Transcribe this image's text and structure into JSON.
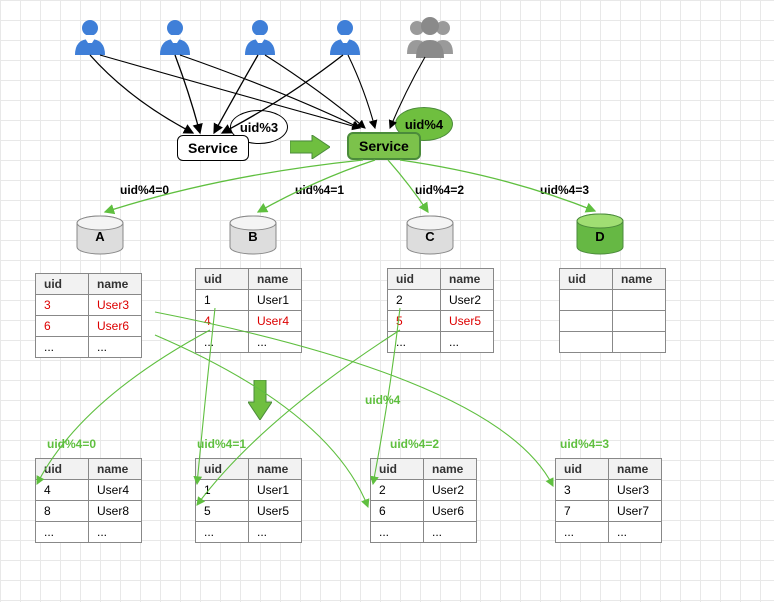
{
  "icons": {
    "user_blue": "#3f7fd8",
    "user_gray": "#9a9a9a"
  },
  "bubbles": {
    "old_rule": "uid%3",
    "new_rule": "uid%4"
  },
  "services": {
    "old": "Service",
    "new": "Service"
  },
  "routes_top": {
    "r0": "uid%4=0",
    "r1": "uid%4=1",
    "r2": "uid%4=2",
    "r3": "uid%4=3"
  },
  "routes_bottom": {
    "mid_label": "uid%4",
    "r0": "uid%4=0",
    "r1": "uid%4=1",
    "r2": "uid%4=2",
    "r3": "uid%4=3"
  },
  "cylinders": {
    "a": "A",
    "b": "B",
    "c": "C",
    "d": "D"
  },
  "tables": {
    "headers": {
      "uid": "uid",
      "name": "name"
    },
    "ellipsis": "...",
    "top": {
      "A": [
        {
          "uid": "3",
          "name": "User3",
          "red": true
        },
        {
          "uid": "6",
          "name": "User6",
          "red": true
        }
      ],
      "B": [
        {
          "uid": "1",
          "name": "User1",
          "red": false
        },
        {
          "uid": "4",
          "name": "User4",
          "red": true
        }
      ],
      "C": [
        {
          "uid": "2",
          "name": "User2",
          "red": false
        },
        {
          "uid": "5",
          "name": "User5",
          "red": true
        }
      ],
      "D": []
    },
    "bottom": {
      "A": [
        {
          "uid": "4",
          "name": "User4"
        },
        {
          "uid": "8",
          "name": "User8"
        }
      ],
      "B": [
        {
          "uid": "1",
          "name": "User1"
        },
        {
          "uid": "5",
          "name": "User5"
        }
      ],
      "C": [
        {
          "uid": "2",
          "name": "User2"
        },
        {
          "uid": "6",
          "name": "User6"
        }
      ],
      "D": [
        {
          "uid": "3",
          "name": "User3"
        },
        {
          "uid": "7",
          "name": "User7"
        }
      ]
    }
  }
}
